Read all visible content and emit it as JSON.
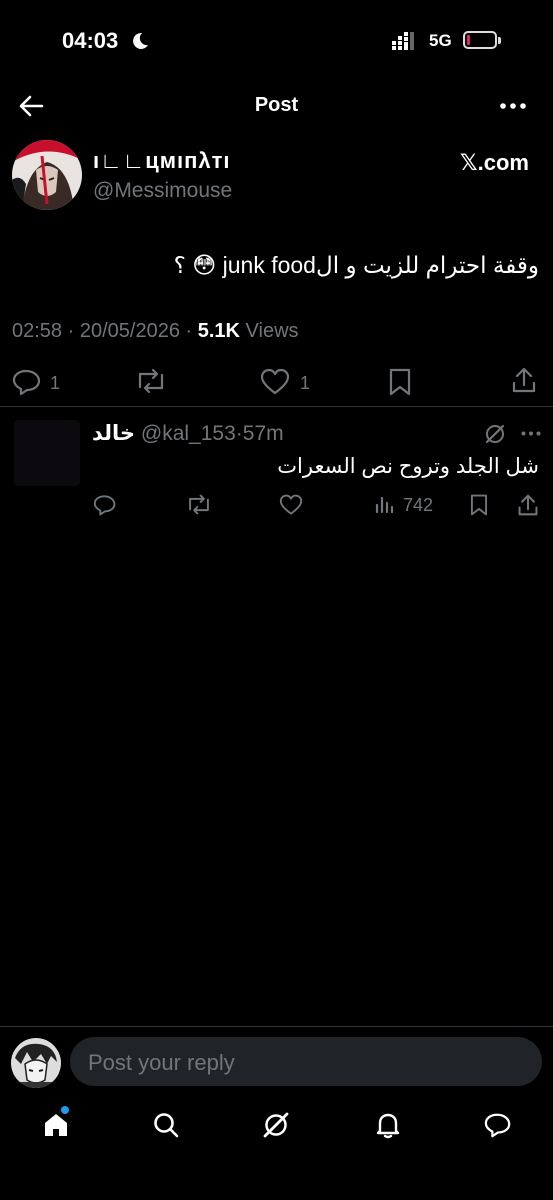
{
  "status_bar": {
    "time": "04:03",
    "network": "5G",
    "battery_color": "#e0245e"
  },
  "header": {
    "title": "Post"
  },
  "tweet": {
    "display_name": "ı∟∟цмıпλтı",
    "handle": "@Messimouse",
    "source": "𝕏.com",
    "text": "وقفة احترام للزيت و الjunk food 😳 ؟",
    "time": "02:58",
    "date": "20/05/2026",
    "views": "5.1K",
    "views_label": "Views",
    "replies": "1",
    "likes": "1"
  },
  "reply": {
    "display_name": "خالد",
    "handle": "@kal_153",
    "age": "57m",
    "text": "شل الجلد وتروح نص السعرات",
    "views": "742"
  },
  "composer": {
    "placeholder": "Post your reply"
  },
  "colors": {
    "background": "#000000",
    "muted": "#71767b",
    "accent": "#1d9bf0",
    "divider": "#2f3336"
  },
  "bottom_nav": [
    "home-icon",
    "search-icon",
    "grok-icon",
    "bell-icon",
    "messages-icon"
  ]
}
